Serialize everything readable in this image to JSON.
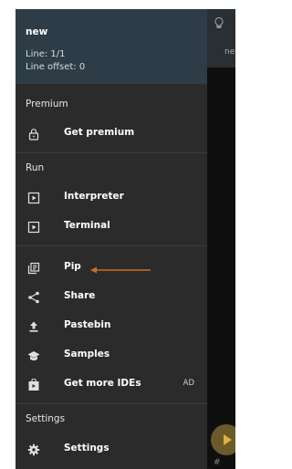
{
  "app": {
    "tab_label": "ne",
    "hash": "#"
  },
  "drawer": {
    "file_name": "new",
    "line": "Line: 1/1",
    "line_offset": "Line offset: 0",
    "sections": {
      "premium": "Premium",
      "run": "Run",
      "settings": "Settings"
    },
    "items": [
      {
        "label": "Get premium",
        "icon": "lock-icon"
      },
      {
        "label": "Interpreter",
        "icon": "play-box-icon"
      },
      {
        "label": "Terminal",
        "icon": "play-box-icon"
      },
      {
        "label": "Pip",
        "icon": "library-icon"
      },
      {
        "label": "Share",
        "icon": "share-icon"
      },
      {
        "label": "Pastebin",
        "icon": "upload-icon"
      },
      {
        "label": "Samples",
        "icon": "school-icon"
      },
      {
        "label": "Get more IDEs",
        "icon": "store-icon",
        "badge": "AD"
      },
      {
        "label": "Settings",
        "icon": "gear-icon"
      }
    ]
  },
  "colors": {
    "drawer_bg": "#2b2b2b",
    "header_bg": "#2d3c47",
    "annotation_arrow": "#d2691e"
  }
}
